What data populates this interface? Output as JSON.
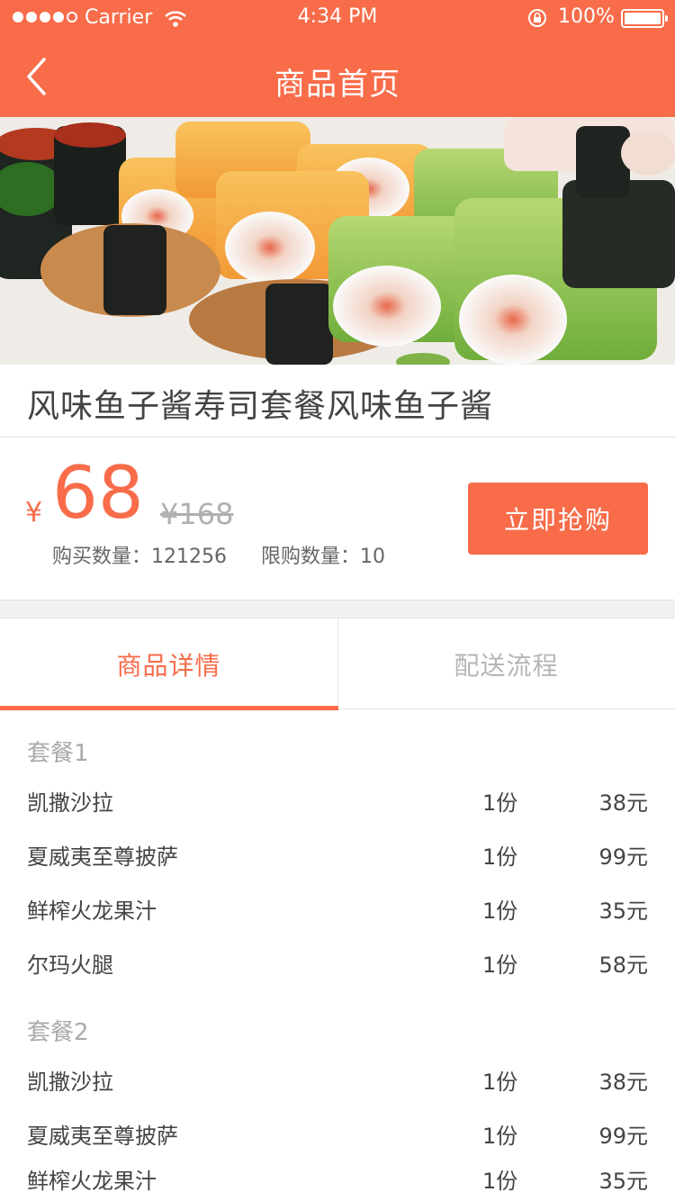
{
  "status_bar": {
    "carrier": "Carrier",
    "time": "4:34 PM",
    "battery": "100%"
  },
  "nav": {
    "title": "商品首页",
    "back_icon": "chevron-left-icon"
  },
  "hero": {
    "image": "sushi-platter-photo"
  },
  "product": {
    "title": "风味鱼子酱寿司套餐风味鱼子酱",
    "currency": "¥",
    "price": "68",
    "original_price": "¥168",
    "sold_label": "购买数量：",
    "sold_value": "121256",
    "limit_label": "限购数量：",
    "limit_value": "10",
    "buy_label": "立即抢购"
  },
  "tabs": [
    {
      "label": "商品详情",
      "active": true
    },
    {
      "label": "配送流程",
      "active": false
    }
  ],
  "packages": [
    {
      "name": "套餐1",
      "items": [
        {
          "name": "凯撒沙拉",
          "qty": "1份",
          "price": "38元"
        },
        {
          "name": "夏威夷至尊披萨",
          "qty": "1份",
          "price": "99元"
        },
        {
          "name": "鲜榨火龙果汁",
          "qty": "1份",
          "price": "35元"
        },
        {
          "name": "尔玛火腿",
          "qty": "1份",
          "price": "58元"
        }
      ]
    },
    {
      "name": "套餐2",
      "items": [
        {
          "name": "凯撒沙拉",
          "qty": "1份",
          "price": "38元"
        },
        {
          "name": "夏威夷至尊披萨",
          "qty": "1份",
          "price": "99元"
        },
        {
          "name": "鲜榨火龙果汁",
          "qty": "1份",
          "price": "35元"
        }
      ]
    }
  ],
  "colors": {
    "accent": "#f86c4a",
    "muted": "#b5b5b5"
  }
}
